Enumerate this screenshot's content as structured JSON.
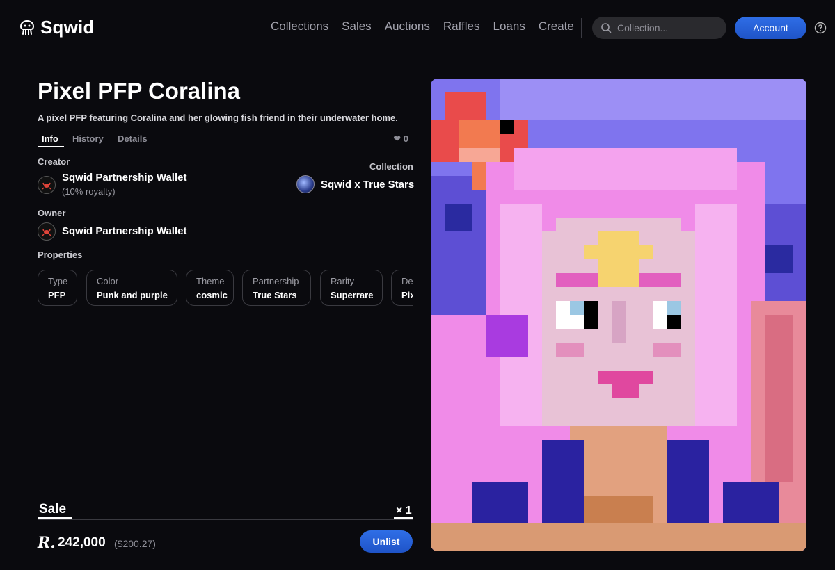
{
  "header": {
    "logo_text": "Sqwid",
    "nav": [
      "Collections",
      "Sales",
      "Auctions",
      "Raffles",
      "Loans",
      "Create"
    ],
    "search_placeholder": "Collection...",
    "account_label": "Account"
  },
  "item": {
    "title": "Pixel PFP Coralina",
    "description": "A pixel PFP featuring Coralina and her glowing fish friend in their underwater home.",
    "tabs": [
      "Info",
      "History",
      "Details"
    ],
    "likes": "❤ 0",
    "creator_label": "Creator",
    "creator_name": "Sqwid Partnership Wallet",
    "creator_royalty": "(10% royalty)",
    "collection_label": "Collection",
    "collection_name": "Sqwid x True Stars",
    "owner_label": "Owner",
    "owner_name": "Sqwid Partnership Wallet",
    "properties_label": "Properties",
    "properties": [
      {
        "key": "Type",
        "value": "PFP"
      },
      {
        "key": "Color",
        "value": "Punk and purple"
      },
      {
        "key": "Theme",
        "value": "cosmic"
      },
      {
        "key": "Partnership",
        "value": "True Stars"
      },
      {
        "key": "Rarity",
        "value": "Superrare"
      },
      {
        "key": "De",
        "value": "Pix"
      }
    ]
  },
  "sale": {
    "title": "Sale",
    "quantity": "× 1",
    "currency_symbol": "R.",
    "price": "242,000",
    "price_usd": "($200.27)",
    "unlist_label": "Unlist"
  },
  "colors": {
    "background": "#0a0a0e",
    "accent_blue": "#2f6ee6"
  },
  "icons": [
    "sqwid-logo-icon",
    "search-icon",
    "help-icon",
    "heart-icon",
    "crab-avatar-icon"
  ]
}
